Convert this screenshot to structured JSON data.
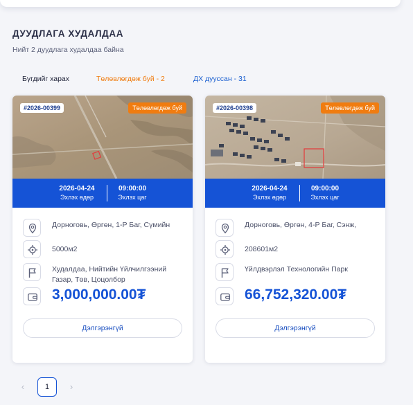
{
  "section": {
    "title": "ДУУДЛАГА ХУДАЛДАА",
    "subtitle": "Нийт 2 дуудлага худалдаа байна"
  },
  "tabs": {
    "all": "Бүгдийг харах",
    "planned": "Төлөвлөгдөж буй - 2",
    "finished": "ДХ дууссан - 31"
  },
  "colors": {
    "accent": "#1553d6",
    "status_orange": "#f07c10"
  },
  "cards": [
    {
      "lot": "#2026-00399",
      "status": "Төлөвлөгдөж буй",
      "start_date": "2026-04-24",
      "start_date_label": "Эхлэх өдөр",
      "start_time": "09:00:00",
      "start_time_label": "Эхлэх цаг",
      "location": "Дорноговь, Өргөн, 1-Р Баг, Сүмийн",
      "area": "5000м2",
      "purpose": "Худалдаа, Нийтийн Үйлчилгээний Газар, Төв, Цоцолбор",
      "price": "3,000,000.00₮",
      "details_button": "Дэлгэрэнгүй",
      "icons": [
        "location-pin-icon",
        "target-icon",
        "flag-icon",
        "wallet-icon"
      ]
    },
    {
      "lot": "#2026-00398",
      "status": "Төлөвлөгдөж буй",
      "start_date": "2026-04-24",
      "start_date_label": "Эхлэх өдөр",
      "start_time": "09:00:00",
      "start_time_label": "Эхлэх цаг",
      "location": "Дорноговь, Өргөн, 4-Р Баг, Сэнж,",
      "area": "208601м2",
      "purpose": "Үйлдвэрлэл Технологийн Парк",
      "price": "66,752,320.00₮",
      "details_button": "Дэлгэрэнгүй",
      "icons": [
        "location-pin-icon",
        "target-icon",
        "flag-icon",
        "wallet-icon"
      ]
    }
  ],
  "pagination": {
    "prev": "‹",
    "current": "1",
    "next": "›"
  }
}
